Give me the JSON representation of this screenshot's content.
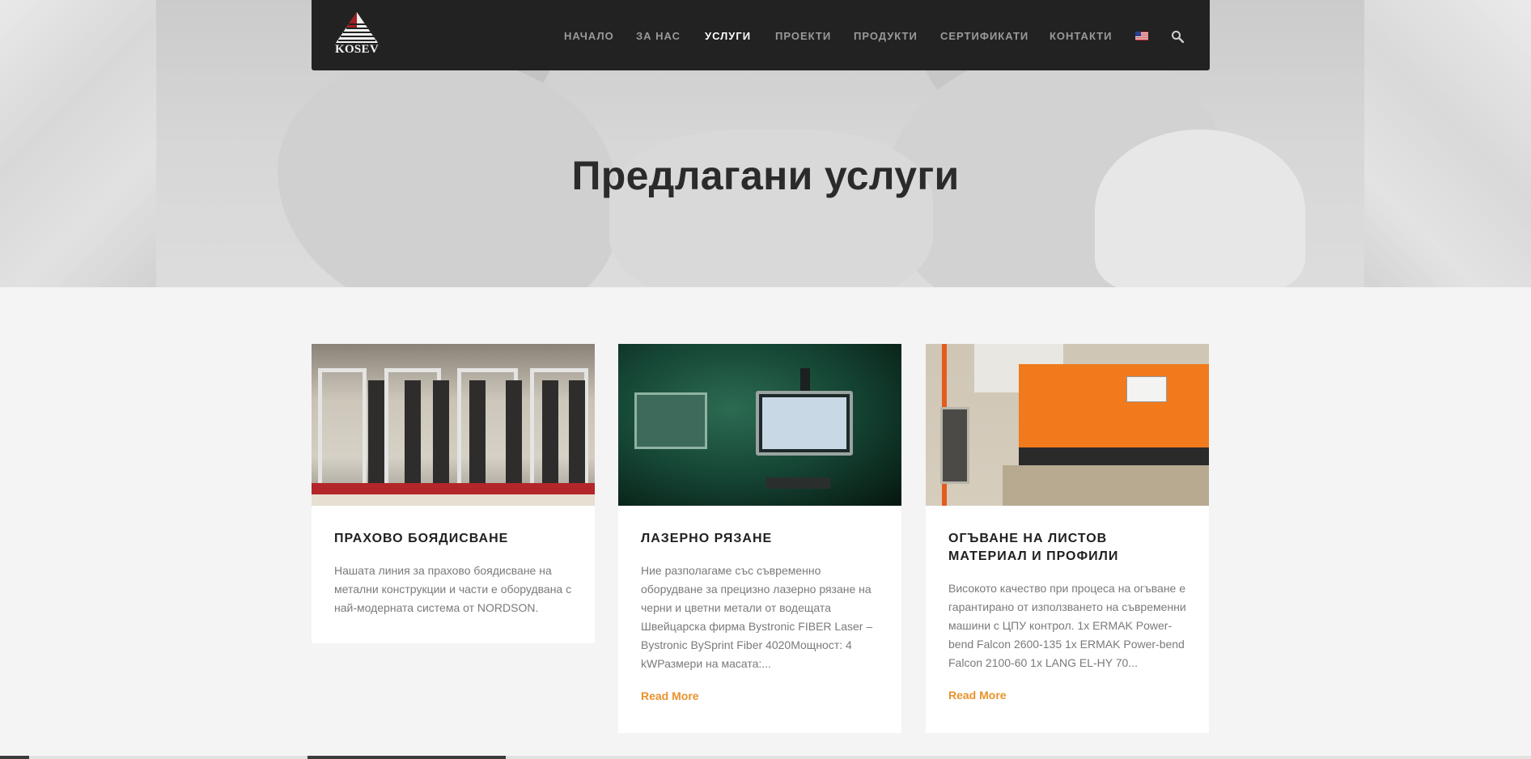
{
  "hero": {
    "title": "Предлагани услуги"
  },
  "navbar": {
    "logo_text": "KOSEV",
    "items": [
      {
        "label": "НАЧАЛО",
        "active": false
      },
      {
        "label": "ЗА НАС",
        "active": false
      },
      {
        "label": "УСЛУГИ",
        "active": true
      },
      {
        "label": "ПРОЕКТИ",
        "active": false
      },
      {
        "label": "ПРОДУКТИ",
        "active": false
      },
      {
        "label": "СЕРТИФИКАТИ",
        "active": false
      },
      {
        "label": "КОНТАКТИ",
        "active": false
      }
    ],
    "language_icon": "us-flag-icon",
    "search_icon": "search-icon"
  },
  "services": [
    {
      "title": "ПРАХОВО БОЯДИСВАНЕ",
      "text": "Нашата линия за прахово боядисване на метални конструкции и части е оборудвана с най-модерната система от NORDSON.",
      "read_more": ""
    },
    {
      "title": "ЛАЗЕРНО РЯЗАНЕ",
      "text": "Ние разполагаме със съвременно оборудване за прецизно лазерно рязане на черни и цветни метали от водещата Швейцарска фирма Bystronic FIBER Laser – Bystronic BySprint Fiber 4020Мощност: 4 kWРазмери на масата:...",
      "read_more": "Read More"
    },
    {
      "title": "ОГЪВАНЕ НА ЛИСТОВ МАТЕРИАЛ И ПРОФИЛИ",
      "text": "Високото качество при процеса на огъване е гарантирано от използването на съвременни машини с ЦПУ контрол. 1x ERMAK Power-bend Falcon 2600-135 1x ERMAK Power-bend Falcon 2100-60 1x LANG EL-HY 70...",
      "read_more": "Read More"
    }
  ],
  "colors": {
    "navbar_bg": "#222222",
    "accent": "#e8922c",
    "page_bg": "#f4f4f4"
  }
}
